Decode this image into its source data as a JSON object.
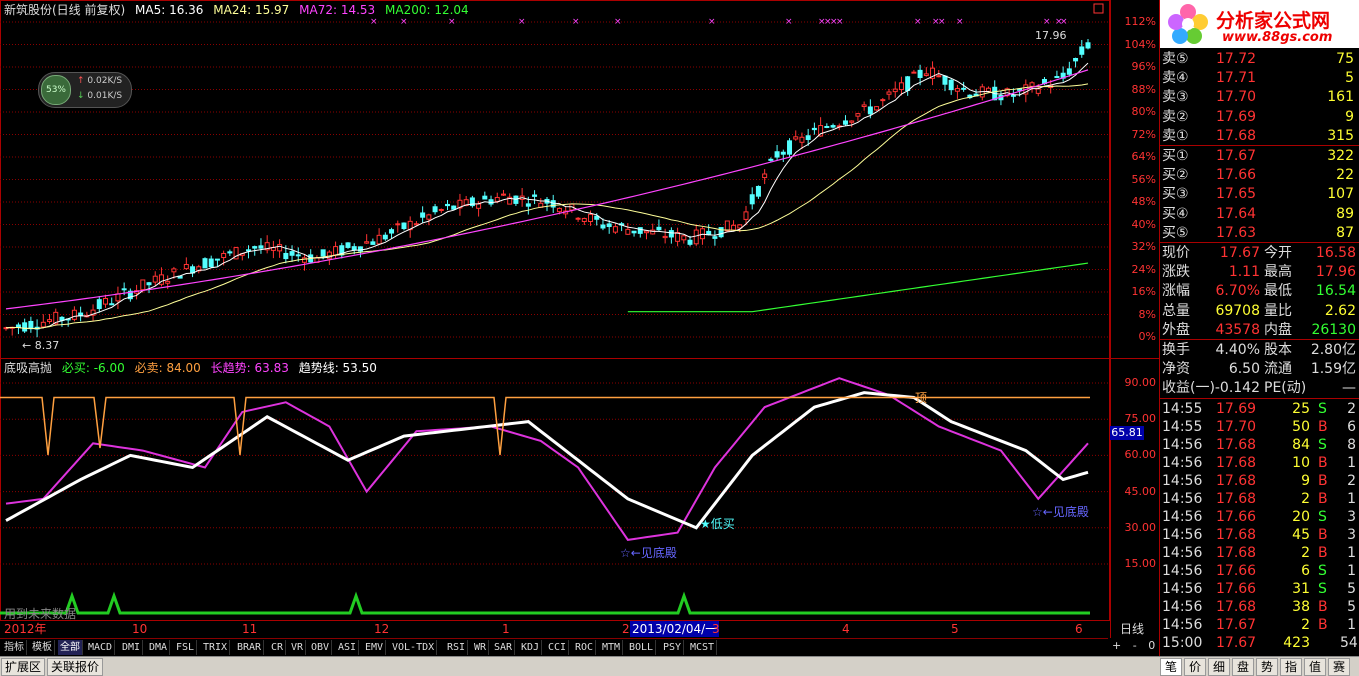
{
  "header": {
    "title": "新筑股份(日线 前复权)",
    "ma5": "MA5: 16.36",
    "ma24": "MA24: 15.97",
    "ma72": "MA72: 14.53",
    "ma200": "MA200: 12.04"
  },
  "net_widget": {
    "percent": "53%",
    "up": "0.02K/S",
    "down": "0.01K/S"
  },
  "price_marks": {
    "high": "17.96",
    "low": "8.37"
  },
  "y_axis_main": [
    "112%",
    "104%",
    "96%",
    "88%",
    "80%",
    "72%",
    "64%",
    "56%",
    "48%",
    "40%",
    "32%",
    "24%",
    "16%",
    "8%",
    "0%"
  ],
  "indicator": {
    "name": "底吸高抛",
    "bixmai": "必买: -6.00",
    "bimai": "必卖: 84.00",
    "long_trend": "长趋势: 63.83",
    "trend_line": "趋势线: 53.50",
    "value_badge": "65.81",
    "ding_label": "顶",
    "dimai_label": "★低买",
    "dibottom_label1": "☆←见底殿",
    "dibottom_label2": "☆←见底殿",
    "bottom_note": "用到未来数据"
  },
  "y_axis_ind": [
    "90.00",
    "75.00",
    "60.00",
    "45.00",
    "30.00",
    "15.00"
  ],
  "dates": {
    "year": "2012年",
    "m10": "10",
    "m11": "11",
    "m12": "12",
    "m1": "1",
    "m2": "2",
    "cursor_date": "2013/02/04/一",
    "m3": "3",
    "m4": "4",
    "m5": "5",
    "m6": "6",
    "period": "日线"
  },
  "tabs": [
    "指标",
    "模板",
    "全部",
    "MACD",
    "DMI",
    "DMA",
    "FSL",
    "TRIX",
    "BRAR",
    "CR",
    "VR",
    "OBV",
    "ASI",
    "EMV",
    "VOL-TDX",
    "RSI",
    "WR",
    "SAR",
    "KDJ",
    "CCI",
    "ROC",
    "MTM",
    "BOLL",
    "PSY",
    "MCST"
  ],
  "tab_controls": [
    "+",
    "-",
    "0"
  ],
  "bottom_buttons": [
    "扩展区",
    "关联报价"
  ],
  "bottom_right_tabs": [
    "笔",
    "价",
    "细",
    "盘",
    "势",
    "指",
    "值",
    "赛"
  ],
  "logo": {
    "title": "分析家公式网",
    "url": "www.88gs.com"
  },
  "quote": {
    "asks": [
      {
        "label": "卖⑤",
        "price": "17.72",
        "vol": "75"
      },
      {
        "label": "卖④",
        "price": "17.71",
        "vol": "5"
      },
      {
        "label": "卖③",
        "price": "17.70",
        "vol": "161"
      },
      {
        "label": "卖②",
        "price": "17.69",
        "vol": "9"
      },
      {
        "label": "卖①",
        "price": "17.68",
        "vol": "315"
      }
    ],
    "bids": [
      {
        "label": "买①",
        "price": "17.67",
        "vol": "322"
      },
      {
        "label": "买②",
        "price": "17.66",
        "vol": "22"
      },
      {
        "label": "买③",
        "price": "17.65",
        "vol": "107"
      },
      {
        "label": "买④",
        "price": "17.64",
        "vol": "89"
      },
      {
        "label": "买⑤",
        "price": "17.63",
        "vol": "87"
      }
    ],
    "stats": [
      {
        "l1": "现价",
        "v1": "17.67",
        "l2": "今开",
        "v2": "16.58"
      },
      {
        "l1": "涨跌",
        "v1": "1.11",
        "l2": "最高",
        "v2": "17.96"
      },
      {
        "l1": "涨幅",
        "v1": "6.70%",
        "l2": "最低",
        "v2": "16.54"
      },
      {
        "l1": "总量",
        "v1": "69708",
        "l2": "量比",
        "v2": "2.62"
      },
      {
        "l1": "外盘",
        "v1": "43578",
        "l2": "内盘",
        "v2": "26130"
      }
    ],
    "info": [
      {
        "l1": "换手",
        "v1": "4.40%",
        "l2": "股本",
        "v2": "2.80亿"
      },
      {
        "l1": "净资",
        "v1": "6.50",
        "l2": "流通",
        "v2": "1.59亿"
      },
      {
        "l1": "收益(一)",
        "v1": "-0.142",
        "l2": "PE(动)",
        "v2": "—"
      }
    ],
    "ticks": [
      {
        "t": "14:55",
        "p": "17.69",
        "v": "25",
        "d": "S",
        "n": "2"
      },
      {
        "t": "14:55",
        "p": "17.70",
        "v": "50",
        "d": "B",
        "n": "6"
      },
      {
        "t": "14:56",
        "p": "17.68",
        "v": "84",
        "d": "S",
        "n": "8"
      },
      {
        "t": "14:56",
        "p": "17.68",
        "v": "10",
        "d": "B",
        "n": "1"
      },
      {
        "t": "14:56",
        "p": "17.68",
        "v": "9",
        "d": "B",
        "n": "2"
      },
      {
        "t": "14:56",
        "p": "17.68",
        "v": "2",
        "d": "B",
        "n": "1"
      },
      {
        "t": "14:56",
        "p": "17.66",
        "v": "20",
        "d": "S",
        "n": "3"
      },
      {
        "t": "14:56",
        "p": "17.68",
        "v": "45",
        "d": "B",
        "n": "3"
      },
      {
        "t": "14:56",
        "p": "17.68",
        "v": "2",
        "d": "B",
        "n": "1"
      },
      {
        "t": "14:56",
        "p": "17.66",
        "v": "6",
        "d": "S",
        "n": "1"
      },
      {
        "t": "14:56",
        "p": "17.66",
        "v": "31",
        "d": "S",
        "n": "5"
      },
      {
        "t": "14:56",
        "p": "17.68",
        "v": "38",
        "d": "B",
        "n": "5"
      },
      {
        "t": "14:56",
        "p": "17.67",
        "v": "2",
        "d": "B",
        "n": "1"
      },
      {
        "t": "15:00",
        "p": "17.67",
        "v": "423",
        "d": "",
        "n": "54"
      }
    ]
  },
  "colors": {
    "up": "#ff3333",
    "down": "#54ffff",
    "ma5": "#ffffff",
    "ma24": "#ffff99",
    "ma72": "#ff44ff",
    "ma200": "#33ff33",
    "grid": "#8b0000",
    "orange": "#ffa040",
    "magenta": "#dd33dd",
    "green": "#22cc22"
  }
}
